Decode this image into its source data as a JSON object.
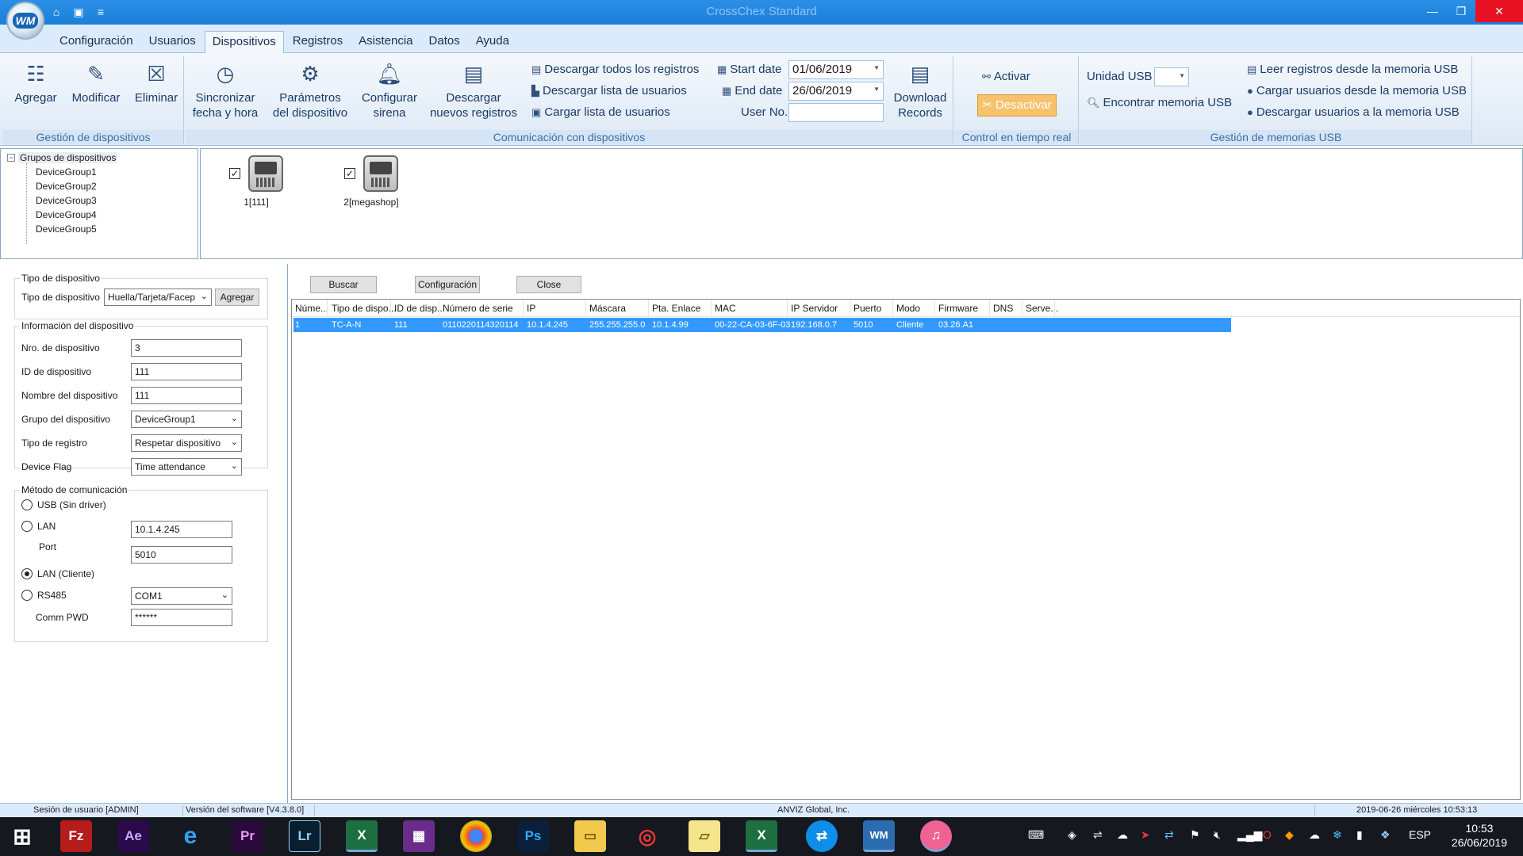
{
  "window": {
    "title": "CrossChex Standard",
    "min_icon": "minimize-icon",
    "max_icon": "maximize-icon",
    "close_icon": "close-icon"
  },
  "menu": {
    "tabs": [
      "Configuración",
      "Usuarios",
      "Dispositivos",
      "Registros",
      "Asistencia",
      "Datos",
      "Ayuda"
    ],
    "active": "Dispositivos"
  },
  "ribbon": {
    "gestion": {
      "label": "Gestión de dispositivos",
      "agregar": "Agregar",
      "modificar": "Modificar",
      "eliminar": "Eliminar"
    },
    "comunicacion": {
      "label": "Comunicación con dispositivos",
      "sync_line1": "Sincronizar",
      "sync_line2": "fecha y hora",
      "params_line1": "Parámetros",
      "params_line2": "del dispositivo",
      "siren_line1": "Configurar",
      "siren_line2": "sirena",
      "newrec_line1": "Descargar",
      "newrec_line2": "nuevos registros",
      "download_all": "Descargar todos los registros",
      "download_users": "Descargar lista de usuarios",
      "upload_users": "Cargar lista de usuarios",
      "start_date_label": "Start date",
      "start_date": "01/06/2019",
      "end_date_label": "End date",
      "end_date": "26/06/2019",
      "user_no_label": "User No.",
      "user_no": "",
      "download_records_line1": "Download",
      "download_records_line2": "Records"
    },
    "tiempo_real": {
      "label": "Control en tiempo real",
      "activar": "Activar",
      "desactivar": "Desactivar"
    },
    "usb": {
      "label": "Gestión de memorias USB",
      "unidad_label": "Unidad USB",
      "find": "Encontrar memoria USB",
      "read_records": "Leer registros desde la memoria USB",
      "upload_from": "Cargar usuarios desde la memoria USB",
      "download_to": "Descargar usuarios a la memoria USB"
    }
  },
  "tree": {
    "root": "Grupos de dispositivos",
    "groups": [
      "DeviceGroup1",
      "DeviceGroup2",
      "DeviceGroup3",
      "DeviceGroup4",
      "DeviceGroup5"
    ]
  },
  "devices": [
    {
      "name": "1[111]",
      "checked": true
    },
    {
      "name": "2[megashop]",
      "checked": true
    }
  ],
  "form": {
    "tipo_section": "Tipo de dispositivo",
    "tipo_label": "Tipo de dispositivo",
    "tipo_value": "Huella/Tarjeta/Facep",
    "agregar": "Agregar",
    "info_section": "Información del dispositivo",
    "nro_label": "Nro. de dispositivo",
    "nro_value": "3",
    "id_label": "ID de dispositivo",
    "id_value": "111",
    "nombre_label": "Nombre del dispositivo",
    "nombre_value": "111",
    "grupo_label": "Grupo del dispositivo",
    "grupo_value": "DeviceGroup1",
    "registro_label": "Tipo de registro",
    "registro_value": "Respetar dispositivo",
    "flag_label": "Device Flag",
    "flag_value": "Time attendance",
    "metodo_section": "Método de comunicación",
    "usb_label": "USB (Sin driver)",
    "lan_label": "LAN",
    "lan_ip": "10.1.4.245",
    "port_label": "Port",
    "port_value": "5010",
    "lan_cliente_label": "LAN (Cliente)",
    "rs485_label": "RS485",
    "com_value": "COM1",
    "pwd_label": "Comm PWD",
    "pwd_value": "******",
    "selected_method": "LAN (Cliente)"
  },
  "toolbar": {
    "buscar": "Buscar",
    "configuracion": "Configuración",
    "close": "Close"
  },
  "table": {
    "headers": [
      "Núme...",
      "Tipo de dispo...",
      "ID de disp...",
      "Número de serie",
      "IP",
      "Máscara",
      "Pta. Enlace",
      "MAC",
      "IP Servidor",
      "Puerto",
      "Modo",
      "Firmware",
      "DNS",
      "Serve..."
    ],
    "rows": [
      [
        "1",
        "TC-A-N",
        "111",
        "0110220114320114",
        "10.1.4.245",
        "255.255.255.0",
        "10.1.4.99",
        "00-22-CA-03-6F-03",
        "192.168.0.7",
        "5010",
        "Cliente",
        "03.26.A1",
        "",
        ""
      ]
    ],
    "selected_row_color": "#3399ff"
  },
  "status": {
    "session": "Sesión de usuario  [ADMIN]",
    "version": "Versión del software  [V4.3.8.0]",
    "company": "ANVIZ Global, Inc.",
    "datetime": "2019-06-26 miércoles 10:53:13"
  },
  "taskbar": {
    "apps": [
      "windows-start",
      "filezilla",
      "after-effects",
      "internet-explorer",
      "premiere",
      "lightroom",
      "excel",
      "winrar",
      "chrome",
      "photoshop",
      "file-explorer",
      "screen-recorder",
      "sticky-notes",
      "excel-2",
      "teamviewer",
      "crosschex",
      "itunes"
    ],
    "lang": "ESP",
    "time": "10:53",
    "date": "26/06/2019"
  },
  "colors": {
    "titlebar": "#1a7fd8",
    "accent": "#3399ff",
    "desactivar_bg": "#f7c26b",
    "ribbon_label": "#3b6ea5"
  }
}
